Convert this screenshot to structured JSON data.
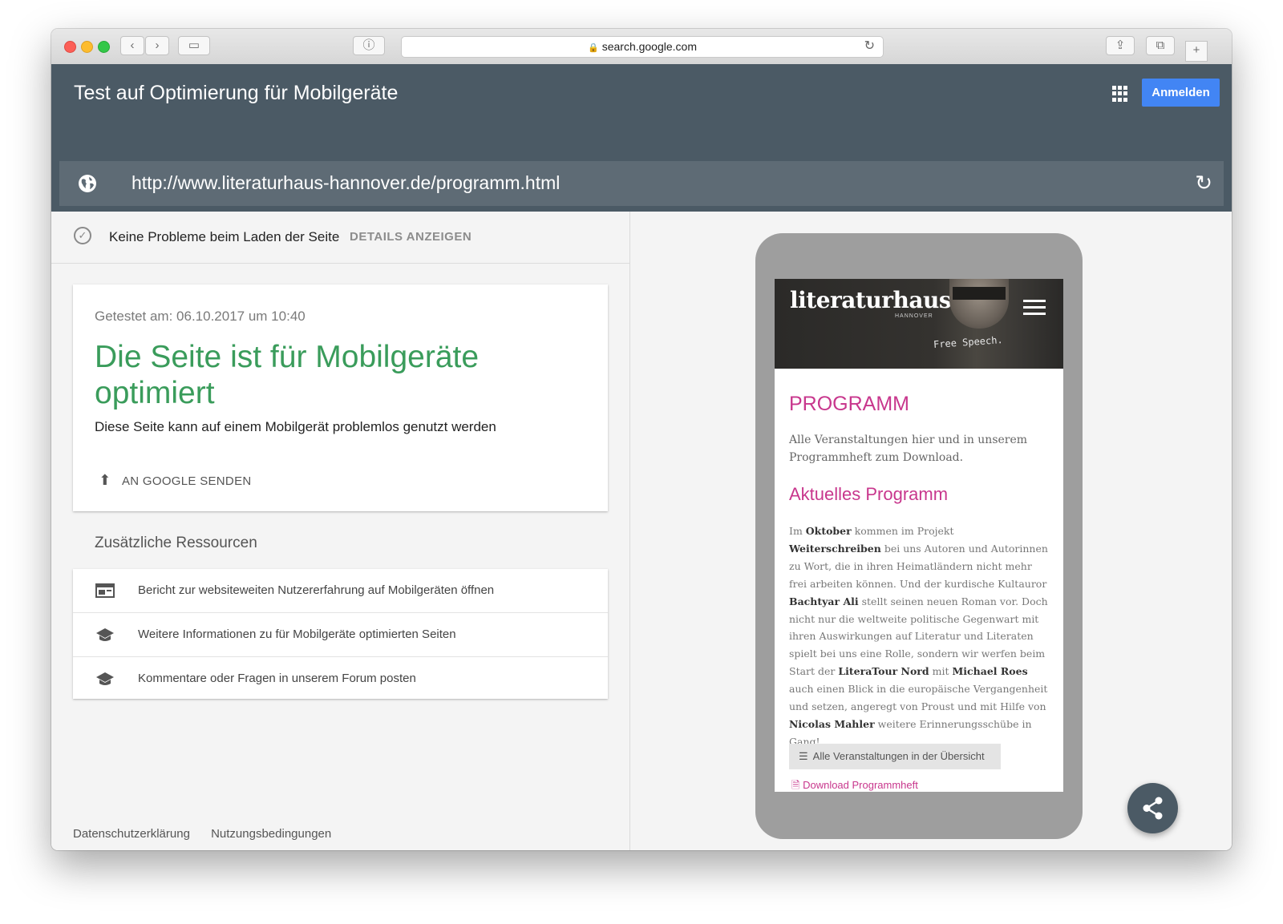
{
  "browser": {
    "address": "search.google.com"
  },
  "header": {
    "title": "Test auf Optimierung für Mobilgeräte",
    "signin_label": "Anmelden",
    "url": "http://www.literaturhaus-hannover.de/programm.html"
  },
  "status": {
    "message": "Keine Probleme beim Laden der Seite",
    "details_label": "DETAILS ANZEIGEN"
  },
  "result": {
    "tested_at": "Getestet am: 06.10.2017 um 10:40",
    "headline": "Die Seite ist für Mobilgeräte optimiert",
    "subtitle": "Diese Seite kann auf einem Mobilgerät problemlos genutzt werden",
    "send_label": "AN GOOGLE SENDEN"
  },
  "resources": {
    "title": "Zusätzliche Ressourcen",
    "items": [
      {
        "label": "Bericht zur websiteweiten Nutzererfahrung auf Mobilgeräten öffnen",
        "icon": "report-icon"
      },
      {
        "label": "Weitere Informationen zu für Mobilgeräte optimierten Seiten",
        "icon": "school-icon"
      },
      {
        "label": "Kommentare oder Fragen in unserem Forum posten",
        "icon": "school-icon"
      }
    ]
  },
  "footer": {
    "privacy": "Datenschutzerklärung",
    "terms": "Nutzungsbedingungen"
  },
  "preview": {
    "logo": "literaturhaus",
    "logo_sub": "HANNOVER",
    "shirt_text": "Free Speech.",
    "page_title": "PROGRAMM",
    "intro": "Alle Veranstaltungen hier und in unserem Programmheft zum Download.",
    "section_title": "Aktuelles Programm",
    "body_parts": [
      "Im ",
      "Oktober",
      " kommen im Projekt ",
      "Weiterschreiben",
      " bei uns Autoren und Autorinnen zu Wort, die in ihren Heimatländern nicht mehr frei arbeiten können. Und der kurdische Kultauror ",
      "Bachtyar Ali",
      " stellt seinen neuen Roman vor. Doch nicht nur die weltweite politische Gegenwart mit ihren Auswirkungen auf Literatur und Literaten spielt bei uns eine Rolle, sondern wir werfen beim Start der ",
      "LiteraTour Nord",
      " mit ",
      "Michael Roes",
      " auch einen Blick in die europäische Vergangenheit und setzen, angeregt von Proust und mit Hilfe von ",
      "Nicolas Mahler",
      " weitere Erinnerungsschübe in Gang!"
    ],
    "overview_button": "Alle Veranstaltungen in der Übersicht",
    "download_link": "Download Programmheft"
  },
  "colors": {
    "header_bg": "#4b5a65",
    "accent_blue": "#4285f4",
    "success_green": "#3a9c5b",
    "magenta": "#c8378d"
  }
}
